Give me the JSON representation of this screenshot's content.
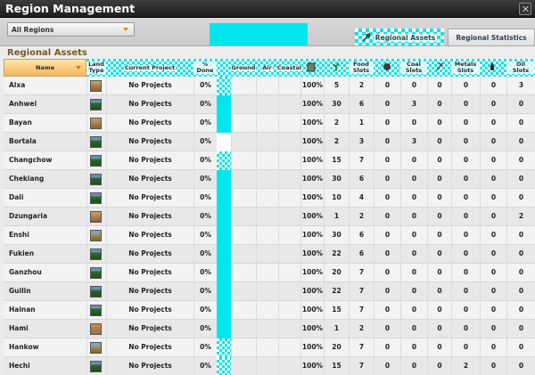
{
  "window": {
    "title": "Region Management"
  },
  "toolbar": {
    "region_filter": "All Regions",
    "tabs": [
      {
        "label": "Regional Assets",
        "icon": "tools-icon",
        "active": true
      },
      {
        "label": "Regional Statistics",
        "icon": "chart-icon",
        "active": false
      }
    ]
  },
  "section": {
    "label": "Regional Assets"
  },
  "columns": {
    "name": "Name",
    "land_type": "Land Type",
    "current_project": "Current Project",
    "pct_done": "% Done",
    "ground": "Ground",
    "air": "Air",
    "coastal": "Coastal",
    "food_slots": "Food Slots",
    "coal_slots": "Coal Slots",
    "metals_slots": "Metals Slots",
    "oil_slots": "Oil Slots"
  },
  "accent_colors": {
    "highlight": "#00e6ec",
    "header_sort": "#f2b75e",
    "section_label": "#7a5a1e"
  },
  "rows": [
    {
      "name": "Alxa",
      "land": "desert",
      "project": "No Projects",
      "pct": "0%",
      "strip": "checker",
      "v1": "100%",
      "v2": "5",
      "food": "2",
      "x1": "0",
      "coal": "0",
      "x2": "0",
      "metal": "0",
      "x3": "0",
      "oil": "3"
    },
    {
      "name": "Anhwei",
      "land": "forest",
      "project": "No Projects",
      "pct": "0%",
      "strip": "solid",
      "v1": "100%",
      "v2": "30",
      "food": "6",
      "x1": "0",
      "coal": "3",
      "x2": "0",
      "metal": "0",
      "x3": "0",
      "oil": "0"
    },
    {
      "name": "Bayan",
      "land": "desert",
      "project": "No Projects",
      "pct": "0%",
      "strip": "solid",
      "v1": "100%",
      "v2": "2",
      "food": "1",
      "x1": "0",
      "coal": "0",
      "x2": "0",
      "metal": "0",
      "x3": "0",
      "oil": "0"
    },
    {
      "name": "Bortala",
      "land": "forest",
      "project": "No Projects",
      "pct": "0%",
      "strip": "white",
      "v1": "100%",
      "v2": "2",
      "food": "3",
      "x1": "0",
      "coal": "3",
      "x2": "0",
      "metal": "0",
      "x3": "0",
      "oil": "0"
    },
    {
      "name": "Changchow",
      "land": "forest",
      "project": "No Projects",
      "pct": "0%",
      "strip": "checker",
      "v1": "100%",
      "v2": "15",
      "food": "7",
      "x1": "0",
      "coal": "0",
      "x2": "0",
      "metal": "0",
      "x3": "0",
      "oil": "0"
    },
    {
      "name": "Chekiang",
      "land": "forest",
      "project": "No Projects",
      "pct": "0%",
      "strip": "solid",
      "v1": "100%",
      "v2": "30",
      "food": "6",
      "x1": "0",
      "coal": "0",
      "x2": "0",
      "metal": "0",
      "x3": "0",
      "oil": "0"
    },
    {
      "name": "Dali",
      "land": "forest",
      "project": "No Projects",
      "pct": "0%",
      "strip": "solid",
      "v1": "100%",
      "v2": "10",
      "food": "4",
      "x1": "0",
      "coal": "0",
      "x2": "0",
      "metal": "0",
      "x3": "0",
      "oil": "0"
    },
    {
      "name": "Dzungaria",
      "land": "desert",
      "project": "No Projects",
      "pct": "0%",
      "strip": "solid",
      "v1": "100%",
      "v2": "1",
      "food": "2",
      "x1": "0",
      "coal": "0",
      "x2": "0",
      "metal": "0",
      "x3": "0",
      "oil": "2"
    },
    {
      "name": "Enshi",
      "land": "grass",
      "project": "No Projects",
      "pct": "0%",
      "strip": "solid",
      "v1": "100%",
      "v2": "30",
      "food": "6",
      "x1": "0",
      "coal": "0",
      "x2": "0",
      "metal": "0",
      "x3": "0",
      "oil": "0"
    },
    {
      "name": "Fukien",
      "land": "forest",
      "project": "No Projects",
      "pct": "0%",
      "strip": "solid",
      "v1": "100%",
      "v2": "22",
      "food": "6",
      "x1": "0",
      "coal": "0",
      "x2": "0",
      "metal": "0",
      "x3": "0",
      "oil": "0"
    },
    {
      "name": "Ganzhou",
      "land": "forest",
      "project": "No Projects",
      "pct": "0%",
      "strip": "solid",
      "v1": "100%",
      "v2": "20",
      "food": "7",
      "x1": "0",
      "coal": "0",
      "x2": "0",
      "metal": "0",
      "x3": "0",
      "oil": "0"
    },
    {
      "name": "Guilin",
      "land": "forest",
      "project": "No Projects",
      "pct": "0%",
      "strip": "solid",
      "v1": "100%",
      "v2": "22",
      "food": "7",
      "x1": "0",
      "coal": "0",
      "x2": "0",
      "metal": "0",
      "x3": "0",
      "oil": "0"
    },
    {
      "name": "Hainan",
      "land": "forest",
      "project": "No Projects",
      "pct": "0%",
      "strip": "solid",
      "v1": "100%",
      "v2": "15",
      "food": "7",
      "x1": "0",
      "coal": "0",
      "x2": "0",
      "metal": "0",
      "x3": "0",
      "oil": "0"
    },
    {
      "name": "Hami",
      "land": "plain",
      "project": "No Projects",
      "pct": "0%",
      "strip": "solid",
      "v1": "100%",
      "v2": "1",
      "food": "2",
      "x1": "0",
      "coal": "0",
      "x2": "0",
      "metal": "0",
      "x3": "0",
      "oil": "0"
    },
    {
      "name": "Hankow",
      "land": "grass",
      "project": "No Projects",
      "pct": "0%",
      "strip": "checker",
      "v1": "100%",
      "v2": "20",
      "food": "7",
      "x1": "0",
      "coal": "0",
      "x2": "0",
      "metal": "0",
      "x3": "0",
      "oil": "0"
    },
    {
      "name": "Hechi",
      "land": "forest",
      "project": "No Projects",
      "pct": "0%",
      "strip": "checker",
      "v1": "100%",
      "v2": "15",
      "food": "7",
      "x1": "0",
      "coal": "0",
      "x2": "0",
      "metal": "2",
      "x3": "0",
      "oil": "0"
    }
  ]
}
